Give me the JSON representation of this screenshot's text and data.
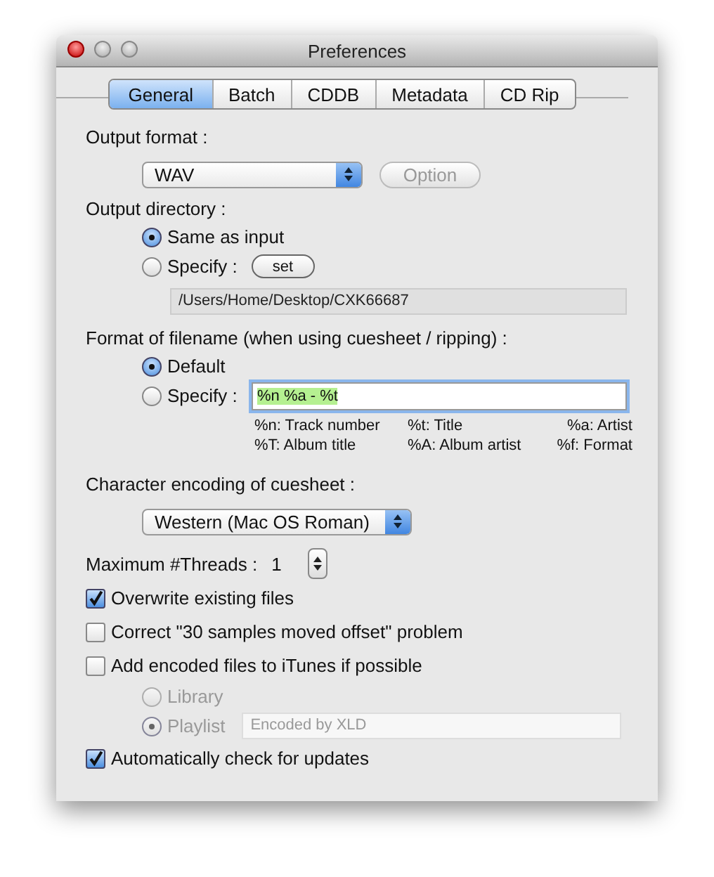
{
  "window": {
    "title": "Preferences"
  },
  "tabs": [
    {
      "label": "General",
      "selected": true
    },
    {
      "label": "Batch",
      "selected": false
    },
    {
      "label": "CDDB",
      "selected": false
    },
    {
      "label": "Metadata",
      "selected": false
    },
    {
      "label": "CD Rip",
      "selected": false
    }
  ],
  "output_format": {
    "label": "Output format :",
    "value": "WAV",
    "option_button": {
      "label": "Option",
      "disabled": true
    }
  },
  "output_directory": {
    "label": "Output directory :",
    "options": [
      {
        "label": "Same as input",
        "selected": true
      },
      {
        "label": "Specify :",
        "selected": false
      }
    ],
    "set_button": "set",
    "path": "/Users/Home/Desktop/CXK66687"
  },
  "filename_format": {
    "label": "Format of filename (when using cuesheet / ripping) :",
    "options": [
      {
        "label": "Default",
        "selected": true
      },
      {
        "label": "Specify :",
        "selected": false
      }
    ],
    "pattern": {
      "value": "%n %a - %t",
      "selected": true,
      "focused": true
    },
    "legend": [
      "%n: Track number",
      "%t: Title",
      "%a: Artist",
      "%T: Album title",
      "%A: Album artist",
      "%f: Format"
    ]
  },
  "encoding": {
    "label": "Character encoding of cuesheet :",
    "value": "Western (Mac OS Roman)"
  },
  "threads": {
    "label": "Maximum #Threads :",
    "value": "1"
  },
  "overwrite": {
    "label": "Overwrite existing files",
    "checked": true
  },
  "correct_offset": {
    "label": "Correct \"30 samples moved offset\" problem",
    "checked": false
  },
  "add_to_itunes": {
    "label": "Add encoded files to iTunes if possible",
    "checked": false,
    "destinations": [
      {
        "label": "Library",
        "selected": false,
        "disabled": true
      },
      {
        "label": "Playlist",
        "selected": true,
        "disabled": true
      }
    ],
    "playlist_name": "Encoded by XLD"
  },
  "auto_update": {
    "label": "Automatically check for updates",
    "checked": true
  }
}
